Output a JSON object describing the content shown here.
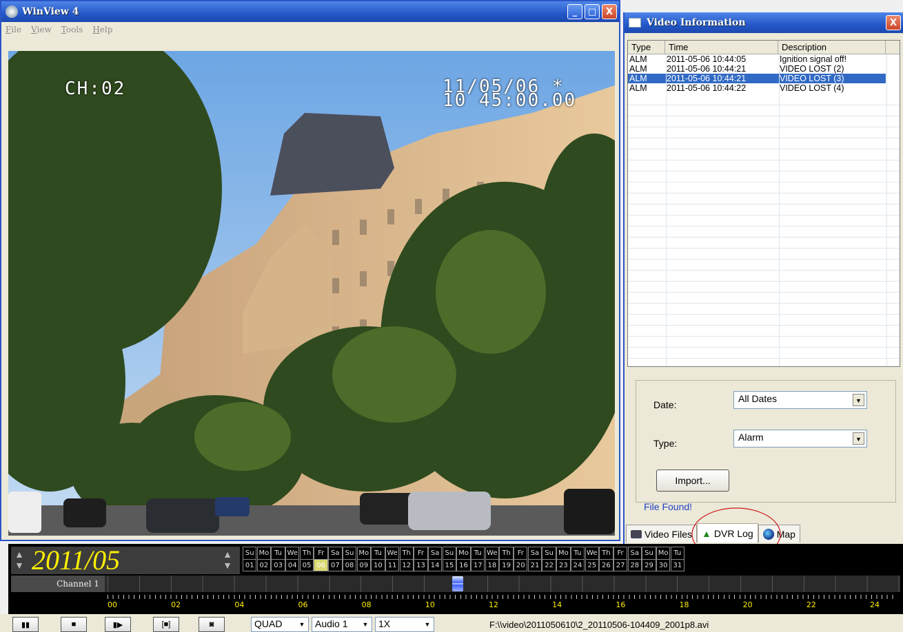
{
  "main_window": {
    "title": "WinView 4",
    "menu": [
      "File",
      "View",
      "Tools",
      "Help"
    ],
    "controls": {
      "minimize": "_",
      "maximize": "□",
      "close": "X"
    }
  },
  "video": {
    "channel": "CH:02",
    "date_osd": "11/05/06 *",
    "time_osd": "10 45:00.00"
  },
  "info_window": {
    "title": "Video Information",
    "close": "X",
    "columns": [
      "Type",
      "Time",
      "Description"
    ],
    "rows": [
      {
        "type": "ALM",
        "time": "2011-05-06 10:44:05",
        "description": "Ignition signal off!"
      },
      {
        "type": "ALM",
        "time": "2011-05-06 10:44:21",
        "description": "VIDEO LOST (2)"
      },
      {
        "type": "ALM",
        "time": "2011-05-06 10:44:21",
        "description": "VIDEO LOST (3)"
      },
      {
        "type": "ALM",
        "time": "2011-05-06 10:44:22",
        "description": "VIDEO LOST (4)"
      }
    ],
    "selected_row": 2,
    "date_label": "Date:",
    "date_value": "All Dates",
    "type_label": "Type:",
    "type_value": "Alarm",
    "import_label": "Import...",
    "status": "File Found!",
    "tabs": [
      "Video Files",
      "DVR Log",
      "Map"
    ],
    "active_tab": 1
  },
  "timeline": {
    "month": "2011/05",
    "day_names": [
      "Su",
      "Mo",
      "Tu",
      "We",
      "Th",
      "Fr",
      "Sa",
      "Su",
      "Mo",
      "Tu",
      "We",
      "Th",
      "Fr",
      "Sa",
      "Su",
      "Mo",
      "Tu",
      "We",
      "Th",
      "Fr",
      "Sa",
      "Su",
      "Mo",
      "Tu",
      "We",
      "Th",
      "Fr",
      "Sa",
      "Su",
      "Mo",
      "Tu"
    ],
    "day_numbers": [
      "01",
      "02",
      "03",
      "04",
      "05",
      "06",
      "07",
      "08",
      "09",
      "10",
      "11",
      "12",
      "13",
      "14",
      "15",
      "16",
      "17",
      "18",
      "19",
      "20",
      "21",
      "22",
      "23",
      "24",
      "25",
      "26",
      "27",
      "28",
      "29",
      "30",
      "31"
    ],
    "selected_day": "06",
    "channel": "Channel 1",
    "hours": [
      "00",
      "02",
      "04",
      "06",
      "08",
      "10",
      "12",
      "14",
      "16",
      "18",
      "20",
      "22",
      "24"
    ]
  },
  "controls": {
    "view_mode": "QUAD",
    "audio": "Audio 1",
    "speed": "1X",
    "file_path": "F:\\\\video\\2011050610\\2_20110506-104409_2001p8.avi"
  },
  "colors": {
    "titlebar": "#2457c8",
    "selection": "#316ac5",
    "timeline_text": "#ffef00"
  }
}
